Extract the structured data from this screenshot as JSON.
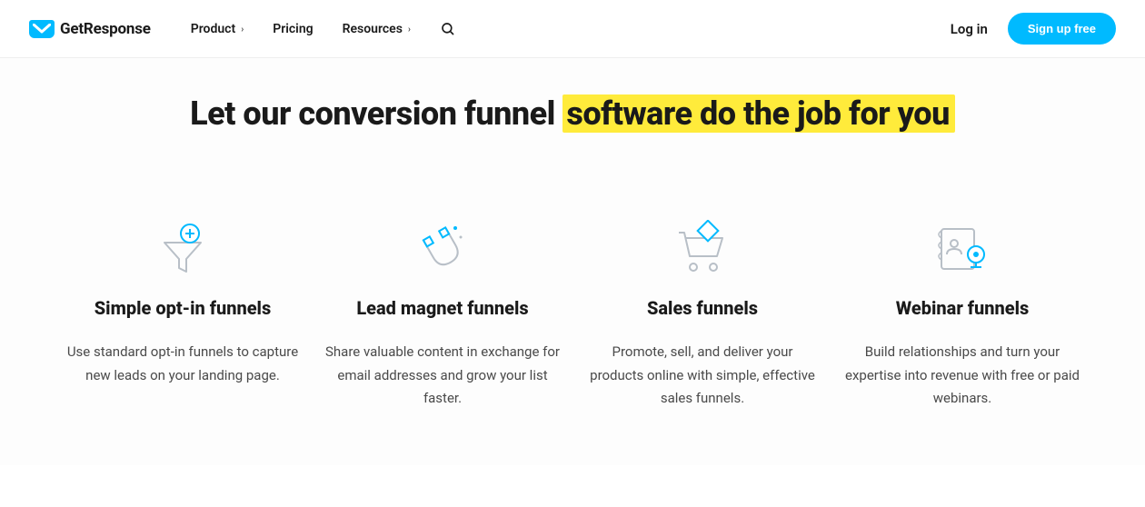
{
  "nav": {
    "brand": "GetResponse",
    "items": [
      {
        "label": "Product",
        "has_dropdown": true
      },
      {
        "label": "Pricing",
        "has_dropdown": false
      },
      {
        "label": "Resources",
        "has_dropdown": true
      }
    ],
    "login_label": "Log in",
    "signup_label": "Sign up free"
  },
  "headline": {
    "part1": "Let our conversion funnel ",
    "highlight": "software do the job for you"
  },
  "features": [
    {
      "title": "Simple opt-in funnels",
      "desc": "Use standard opt-in funnels to capture new leads on your landing page.",
      "icon": "funnel-plus-icon"
    },
    {
      "title": "Lead magnet funnels",
      "desc": "Share valuable content in exchange for email addresses and grow your list faster.",
      "icon": "magnet-icon"
    },
    {
      "title": "Sales funnels",
      "desc": "Promote, sell, and deliver your products online with simple, effective sales funnels.",
      "icon": "cart-icon"
    },
    {
      "title": "Webinar funnels",
      "desc": "Build relationships and turn your expertise into revenue with free or paid webinars.",
      "icon": "webinar-icon"
    }
  ],
  "colors": {
    "accent": "#00baff",
    "highlight": "#ffeb3b"
  }
}
